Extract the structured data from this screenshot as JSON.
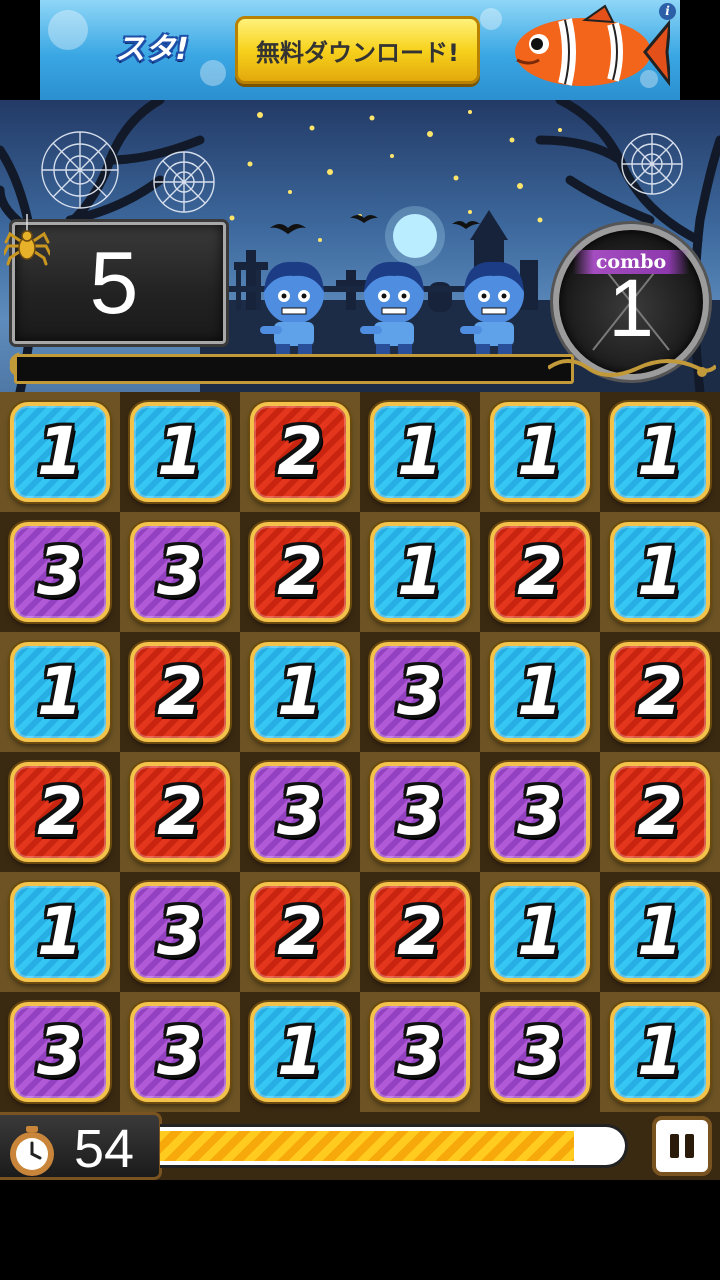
{
  "ad": {
    "logo_text": "スタ!",
    "cta_label": "無料ダウンロード!",
    "info_icon": "info-icon"
  },
  "hud": {
    "score": "5",
    "combo_label": "combo",
    "combo_value": "1",
    "spider_icon": "spider-icon"
  },
  "board": {
    "rows": [
      [
        "1",
        "1",
        "2",
        "1",
        "1",
        "1"
      ],
      [
        "3",
        "3",
        "2",
        "1",
        "2",
        "1"
      ],
      [
        "1",
        "2",
        "1",
        "3",
        "1",
        "2"
      ],
      [
        "2",
        "2",
        "3",
        "3",
        "3",
        "2"
      ],
      [
        "1",
        "3",
        "2",
        "2",
        "1",
        "1"
      ],
      [
        "3",
        "3",
        "1",
        "3",
        "3",
        "1"
      ]
    ]
  },
  "timer": {
    "seconds": "54",
    "remaining_fraction": 0.89,
    "clock_icon": "clock-icon"
  },
  "controls": {
    "pause_icon": "pause-icon"
  },
  "colors": {
    "tile_1": "#36c6f3",
    "tile_2": "#e3361c",
    "tile_3": "#b05ad8",
    "tile_border": "#f2c24a",
    "timer_fill": "#ffcb1f"
  }
}
